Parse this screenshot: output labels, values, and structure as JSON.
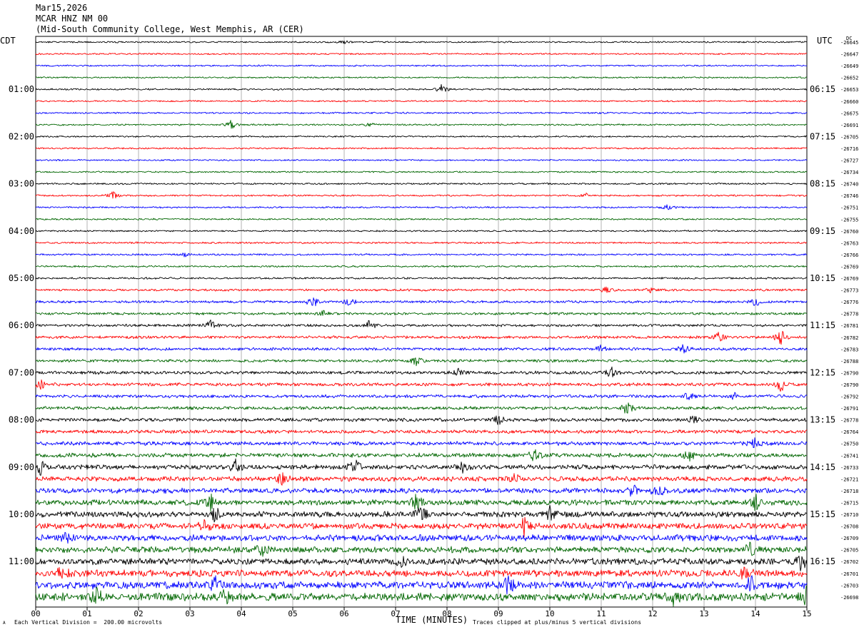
{
  "header": {
    "date": "Mar15,2026",
    "station": "MCAR HNZ NM 00",
    "location": "(Mid-South Community College, West Memphis, AR (CER)"
  },
  "colors": {
    "trace_cycle": [
      "#000000",
      "#ff0000",
      "#0000ff",
      "#006600"
    ],
    "grid": "#808080"
  },
  "footer": {
    "scale_text": "Each Vertical Division =  200.00 microvolts",
    "clip_text": "Traces clipped at plus/minus 5 vertical divisions",
    "corner_mark": "A"
  },
  "chart_data": {
    "type": "line",
    "title": "",
    "xlabel": "TIME (MINUTES)",
    "xlim": [
      0,
      15
    ],
    "x_ticks": [
      "00",
      "01",
      "02",
      "03",
      "04",
      "05",
      "06",
      "07",
      "08",
      "09",
      "10",
      "11",
      "12",
      "13",
      "14",
      "15"
    ],
    "left_axis_label": "CDT",
    "right_axis_label": "UTC",
    "dc_label": "DC",
    "left_hour_labels": [
      {
        "row": 4,
        "text": "01:00"
      },
      {
        "row": 8,
        "text": "02:00"
      },
      {
        "row": 12,
        "text": "03:00"
      },
      {
        "row": 16,
        "text": "04:00"
      },
      {
        "row": 20,
        "text": "05:00"
      },
      {
        "row": 24,
        "text": "06:00"
      },
      {
        "row": 28,
        "text": "07:00"
      },
      {
        "row": 32,
        "text": "08:00"
      },
      {
        "row": 36,
        "text": "09:00"
      },
      {
        "row": 40,
        "text": "10:00"
      },
      {
        "row": 44,
        "text": "11:00"
      }
    ],
    "right_hour_labels": [
      {
        "row": 4,
        "text": "06:15"
      },
      {
        "row": 8,
        "text": "07:15"
      },
      {
        "row": 12,
        "text": "08:15"
      },
      {
        "row": 16,
        "text": "09:15"
      },
      {
        "row": 20,
        "text": "10:15"
      },
      {
        "row": 24,
        "text": "11:15"
      },
      {
        "row": 28,
        "text": "12:15"
      },
      {
        "row": 32,
        "text": "13:15"
      },
      {
        "row": 36,
        "text": "14:15"
      },
      {
        "row": 40,
        "text": "15:15"
      },
      {
        "row": 44,
        "text": "16:15"
      }
    ],
    "dc_offsets": [
      "-26645",
      "-26647",
      "-26649",
      "-26652",
      "-26653",
      "-26660",
      "-26675",
      "-26691",
      "-26705",
      "-26716",
      "-26727",
      "-26734",
      "-26740",
      "-26746",
      "-26751",
      "-26755",
      "-26760",
      "-26763",
      "-26766",
      "-26769",
      "-26769",
      "-26773",
      "-26776",
      "-26778",
      "-26781",
      "-26782",
      "-26783",
      "-26788",
      "-26790",
      "-26790",
      "-26792",
      "-26791",
      "-26778",
      "-26764",
      "-26750",
      "-26741",
      "-26733",
      "-26721",
      "-26718",
      "-26715",
      "-26710",
      "-26708",
      "-26709",
      "-26705",
      "-26702",
      "-26701",
      "-26703",
      "-26698"
    ],
    "trace_amplitude": [
      1.2,
      1.2,
      1.2,
      1.2,
      1.3,
      1.2,
      1.3,
      1.3,
      1.2,
      1.2,
      1.2,
      1.2,
      1.3,
      1.3,
      1.3,
      1.3,
      1.3,
      1.4,
      1.4,
      1.4,
      1.5,
      1.7,
      2.0,
      2.0,
      2.0,
      2.2,
      2.2,
      2.2,
      2.5,
      2.5,
      2.5,
      2.5,
      2.7,
      2.8,
      3.0,
      3.3,
      3.6,
      3.8,
      4.0,
      4.3,
      4.5,
      4.7,
      4.8,
      4.9,
      5.0,
      5.3,
      5.8,
      6.0
    ],
    "events": [
      {
        "row": 0,
        "minute": 6.0,
        "amp": 4
      },
      {
        "row": 4,
        "minute": 7.9,
        "amp": 7
      },
      {
        "row": 7,
        "minute": 3.8,
        "amp": 6
      },
      {
        "row": 7,
        "minute": 6.5,
        "amp": 3
      },
      {
        "row": 13,
        "minute": 1.5,
        "amp": 6
      },
      {
        "row": 13,
        "minute": 10.7,
        "amp": 3
      },
      {
        "row": 14,
        "minute": 12.3,
        "amp": 4
      },
      {
        "row": 18,
        "minute": 2.9,
        "amp": 3
      },
      {
        "row": 21,
        "minute": 11.1,
        "amp": 5
      },
      {
        "row": 21,
        "minute": 12.0,
        "amp": 5
      },
      {
        "row": 22,
        "minute": 5.4,
        "amp": 9
      },
      {
        "row": 22,
        "minute": 6.1,
        "amp": 6
      },
      {
        "row": 22,
        "minute": 14.0,
        "amp": 6
      },
      {
        "row": 23,
        "minute": 5.6,
        "amp": 5
      },
      {
        "row": 24,
        "minute": 3.4,
        "amp": 8
      },
      {
        "row": 24,
        "minute": 6.5,
        "amp": 8
      },
      {
        "row": 25,
        "minute": 14.5,
        "amp": 12
      },
      {
        "row": 25,
        "minute": 13.3,
        "amp": 9
      },
      {
        "row": 26,
        "minute": 12.6,
        "amp": 8
      },
      {
        "row": 26,
        "minute": 11.0,
        "amp": 5
      },
      {
        "row": 27,
        "minute": 7.4,
        "amp": 7
      },
      {
        "row": 28,
        "minute": 11.2,
        "amp": 8
      },
      {
        "row": 28,
        "minute": 8.2,
        "amp": 6
      },
      {
        "row": 29,
        "minute": 0.1,
        "amp": 9
      },
      {
        "row": 29,
        "minute": 14.5,
        "amp": 11
      },
      {
        "row": 30,
        "minute": 12.7,
        "amp": 6
      },
      {
        "row": 30,
        "minute": 13.6,
        "amp": 6
      },
      {
        "row": 31,
        "minute": 11.5,
        "amp": 9
      },
      {
        "row": 32,
        "minute": 9.0,
        "amp": 7
      },
      {
        "row": 32,
        "minute": 12.8,
        "amp": 7
      },
      {
        "row": 34,
        "minute": 14.0,
        "amp": 8
      },
      {
        "row": 35,
        "minute": 9.7,
        "amp": 9
      },
      {
        "row": 35,
        "minute": 12.7,
        "amp": 9
      },
      {
        "row": 36,
        "minute": 0.1,
        "amp": 12
      },
      {
        "row": 36,
        "minute": 3.9,
        "amp": 10
      },
      {
        "row": 36,
        "minute": 6.2,
        "amp": 14
      },
      {
        "row": 36,
        "minute": 8.3,
        "amp": 7
      },
      {
        "row": 37,
        "minute": 4.8,
        "amp": 9
      },
      {
        "row": 37,
        "minute": 9.3,
        "amp": 8
      },
      {
        "row": 38,
        "minute": 11.6,
        "amp": 9
      },
      {
        "row": 38,
        "minute": 12.1,
        "amp": 9
      },
      {
        "row": 39,
        "minute": 3.4,
        "amp": 12
      },
      {
        "row": 39,
        "minute": 7.4,
        "amp": 11
      },
      {
        "row": 39,
        "minute": 14.0,
        "amp": 10
      },
      {
        "row": 40,
        "minute": 3.5,
        "amp": 13
      },
      {
        "row": 40,
        "minute": 7.5,
        "amp": 12
      },
      {
        "row": 40,
        "minute": 10.0,
        "amp": 10
      },
      {
        "row": 41,
        "minute": 9.5,
        "amp": 14
      },
      {
        "row": 41,
        "minute": 3.3,
        "amp": 8
      },
      {
        "row": 42,
        "minute": 0.6,
        "amp": 8
      },
      {
        "row": 43,
        "minute": 4.4,
        "amp": 9
      },
      {
        "row": 43,
        "minute": 13.9,
        "amp": 9
      },
      {
        "row": 44,
        "minute": 7.1,
        "amp": 9
      },
      {
        "row": 44,
        "minute": 14.9,
        "amp": 14
      },
      {
        "row": 45,
        "minute": 0.5,
        "amp": 10
      },
      {
        "row": 45,
        "minute": 13.8,
        "amp": 12
      },
      {
        "row": 46,
        "minute": 9.2,
        "amp": 15
      },
      {
        "row": 46,
        "minute": 13.9,
        "amp": 14
      },
      {
        "row": 46,
        "minute": 3.5,
        "amp": 11
      },
      {
        "row": 47,
        "minute": 1.2,
        "amp": 15
      },
      {
        "row": 47,
        "minute": 3.7,
        "amp": 13
      },
      {
        "row": 47,
        "minute": 12.4,
        "amp": 15
      },
      {
        "row": 47,
        "minute": 15.0,
        "amp": 13
      }
    ]
  }
}
